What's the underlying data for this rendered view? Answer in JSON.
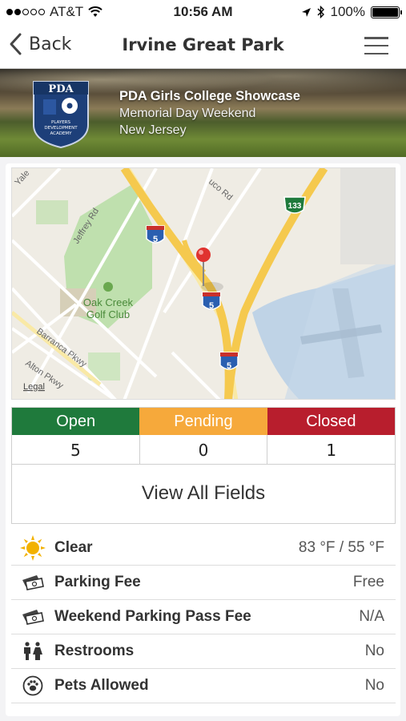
{
  "status_bar": {
    "carrier": "AT&T",
    "time": "10:56 AM",
    "battery": "100%"
  },
  "nav": {
    "back_label": "Back",
    "title": "Irvine Great Park"
  },
  "banner": {
    "logo_text": "PDA",
    "logo_subtext": "PLAYERS DEVELOPMENT ACADEMY",
    "event_title": "PDA Girls College Showcase",
    "event_subtitle": "Memorial Day Weekend",
    "location": "New Jersey"
  },
  "map": {
    "labels": {
      "yale": "Yale",
      "jeffrey": "Jeffrey Rd",
      "barranca": "Barranca Pkwy",
      "alton": "Alton Pkwy",
      "oakcreek1": "Oak Creek",
      "oakcreek2": "Golf Club",
      "sanbernardino": "uco Rd",
      "legal": "Legal",
      "i5": "5",
      "ca133": "133"
    }
  },
  "fields_status": {
    "headers": {
      "open": "Open",
      "pending": "Pending",
      "closed": "Closed"
    },
    "values": {
      "open": "5",
      "pending": "0",
      "closed": "1"
    },
    "colors": {
      "open": "#1f7a3c",
      "pending": "#f6a93b",
      "closed": "#b81e2d"
    }
  },
  "view_all_label": "View All Fields",
  "info_rows": [
    {
      "icon": "sun-icon",
      "label": "Clear",
      "value": "83 °F / 55 °F"
    },
    {
      "icon": "ticket-icon",
      "label": "Parking Fee",
      "value": "Free"
    },
    {
      "icon": "ticket-icon",
      "label": "Weekend Parking Pass Fee",
      "value": "N/A"
    },
    {
      "icon": "restroom-icon",
      "label": "Restrooms",
      "value": "No"
    },
    {
      "icon": "paw-icon",
      "label": "Pets Allowed",
      "value": "No"
    }
  ]
}
